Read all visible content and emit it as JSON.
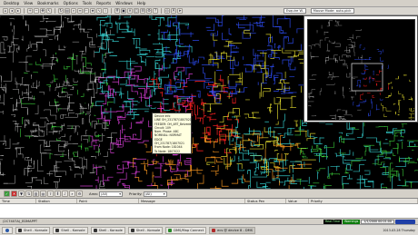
{
  "menu": [
    "Desktop",
    "View",
    "Bookmarks",
    "Options",
    "Tools",
    "Reports",
    "Windows",
    "Help"
  ],
  "toolbar": {
    "layer_label": "Esquire W.",
    "mode_label": "Mouse Mode: auto-pick"
  },
  "colors": {
    "map_bg": "#000000",
    "feeder_cyan": "#36d6d6",
    "feeder_blue": "#3050ff",
    "feeder_red": "#ff2020",
    "feeder_magenta": "#e040e0",
    "feeder_orange": "#ff9a20",
    "feeder_yellow": "#e8e030",
    "feeder_green": "#40e040",
    "feeder_white": "#e8e8e8"
  },
  "tooltip": {
    "lines": [
      "Device info",
      "LINE OH_231787/1807021",
      "FEEDER: OH_ART_Belvedere 2",
      "Circuit: 109",
      "",
      "Nom. Phase: ABC",
      "NOMINAL: NORMAT",
      "",
      "EDGE",
      "OH_231787/1807021",
      "From Node: 181044",
      "To Node: 1807022"
    ]
  },
  "filter": {
    "area_label": "Area:",
    "area_value": "(All)",
    "priority_label": "Priority:",
    "priority_value": "(All)"
  },
  "alarm_columns": [
    "Time",
    "Station",
    "Point",
    "Message",
    "Status Pen",
    "Value",
    "Priority"
  ],
  "status": {
    "left": "(2C7407A)_EDMAPPT",
    "freeze": "Real-Time",
    "warn": "Warnings",
    "time": "1/1/2000 00:01:00"
  },
  "taskbar": {
    "tasks": [
      {
        "label": "Shell - Konsole"
      },
      {
        "label": "Shell - Konsole"
      },
      {
        "label": "Shell - Konsole"
      },
      {
        "label": "Shell - Konsole"
      },
      {
        "label": "DMS/Map Connect"
      },
      {
        "label": "ecs @ device 8 - DMS"
      }
    ],
    "tray": "2013-03-28 Thursday"
  }
}
